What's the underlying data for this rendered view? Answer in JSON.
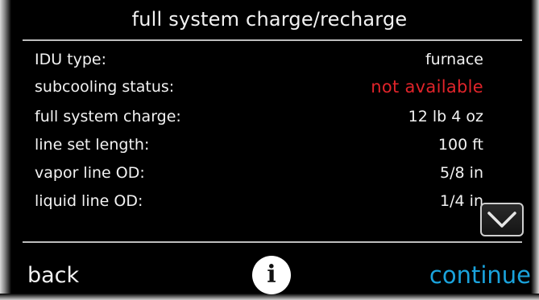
{
  "screen": {
    "title": "full system charge/recharge"
  },
  "rows": [
    {
      "label": "IDU type:",
      "value": "furnace"
    },
    {
      "label": "subcooling status:",
      "value": "not available"
    },
    {
      "label": "full system charge:",
      "value": "12 lb 4 oz"
    },
    {
      "label": "line set length:",
      "value": "100 ft"
    },
    {
      "label": "vapor line OD:",
      "value": "5/8 in"
    },
    {
      "label": "liquid line OD:",
      "value": "1/4 in"
    }
  ],
  "footer": {
    "back_label": "back",
    "info_symbol": "i",
    "continue_label": "continue"
  },
  "icons": {
    "scroll": "chevron-down-icon",
    "info": "info-icon"
  },
  "colors": {
    "background": "#000000",
    "text": "#f2f2f2",
    "alert": "#e0242a",
    "accent": "#1aa3dc",
    "divider": "#bdbdbd"
  }
}
